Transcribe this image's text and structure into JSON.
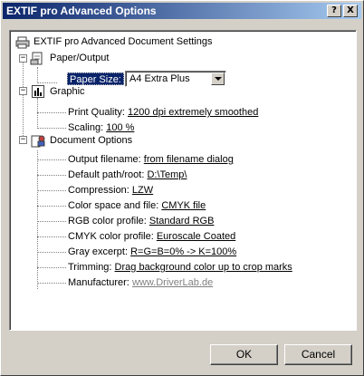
{
  "window": {
    "title": "EXTIF pro Advanced Options",
    "help_glyph": "?",
    "close_glyph": "X"
  },
  "tree": {
    "root": "EXTIF pro Advanced Document Settings",
    "paper": {
      "label": "Paper/Output",
      "paper_size_label": "Paper Size:",
      "paper_size_value": "A4 Extra Plus"
    },
    "graphic": {
      "label": "Graphic",
      "items": [
        {
          "label": "Print Quality:",
          "value": "1200 dpi extremely smoothed"
        },
        {
          "label": "Scaling:",
          "value": "100 %"
        }
      ]
    },
    "document": {
      "label": "Document Options",
      "items": [
        {
          "label": "Output filename:",
          "value": "from filename dialog"
        },
        {
          "label": "Default path/root:",
          "value": "D:\\Temp\\"
        },
        {
          "label": "Compression:",
          "value": "LZW"
        },
        {
          "label": "Color space and file:",
          "value": "CMYK file"
        },
        {
          "label": "RGB color profile:",
          "value": "Standard RGB"
        },
        {
          "label": "CMYK color profile:",
          "value": "Euroscale Coated"
        },
        {
          "label": "Gray excerpt:",
          "value": "R=G=B=0% -> K=100%"
        },
        {
          "label": "Trimming:",
          "value": "Drag background color up to crop marks"
        },
        {
          "label": "Manufacturer:",
          "value": "www.DriverLab.de"
        }
      ]
    }
  },
  "buttons": {
    "ok": "OK",
    "cancel": "Cancel"
  },
  "icons": {
    "root": "printer-icon",
    "paper": "paper-icon",
    "graphic": "graphic-icon",
    "document": "document-options-icon"
  },
  "colors": {
    "selection": "#0a246a",
    "face": "#d4d0c8"
  }
}
